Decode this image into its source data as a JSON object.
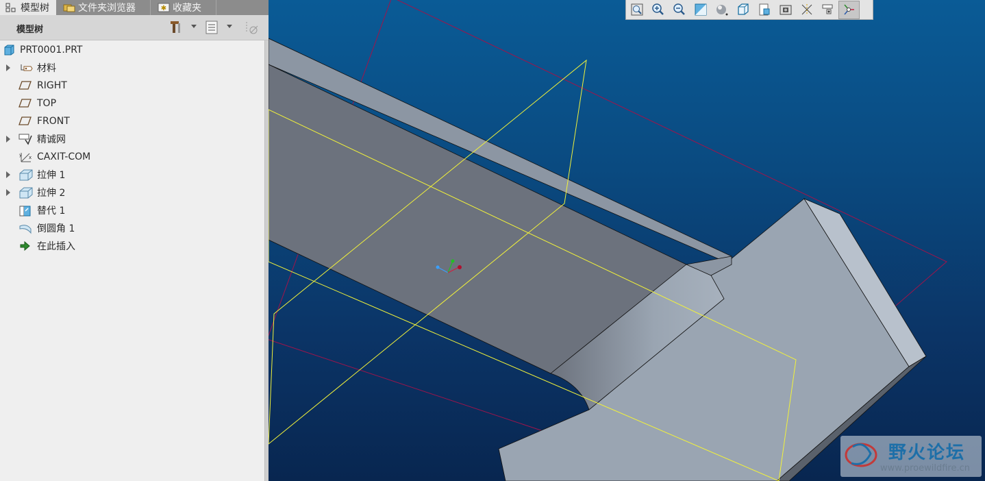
{
  "tabs": [
    {
      "label": "模型树",
      "icon": "model-tree-icon"
    },
    {
      "label": "文件夹浏览器",
      "icon": "folder-browser-icon"
    },
    {
      "label": "收藏夹",
      "icon": "favorites-icon"
    }
  ],
  "tree_header": {
    "title": "模型树",
    "buttons": [
      "tools-icon",
      "settings-list-icon",
      "show-hide-icon"
    ]
  },
  "tree": {
    "root": {
      "label": "PRT0001.PRT",
      "icon": "part-icon"
    },
    "items": [
      {
        "label": "材料",
        "icon": "material-icon",
        "expandable": true
      },
      {
        "label": "RIGHT",
        "icon": "datum-plane-icon",
        "expandable": false
      },
      {
        "label": "TOP",
        "icon": "datum-plane-icon",
        "expandable": false
      },
      {
        "label": "FRONT",
        "icon": "datum-plane-icon",
        "expandable": false
      },
      {
        "label": "精诚网",
        "icon": "feature-icon",
        "expandable": true
      },
      {
        "label": "CAXIT-COM",
        "icon": "coordinate-system-icon",
        "expandable": false
      },
      {
        "label": "拉伸 1",
        "icon": "extrude-icon",
        "expandable": true
      },
      {
        "label": "拉伸 2",
        "icon": "extrude-icon",
        "expandable": true
      },
      {
        "label": "替代 1",
        "icon": "substitute-icon",
        "expandable": false
      },
      {
        "label": "倒圆角 1",
        "icon": "round-icon",
        "expandable": false
      },
      {
        "label": "在此插入",
        "icon": "insert-here-icon",
        "expandable": false
      }
    ]
  },
  "view_toolbar": [
    "refit-icon",
    "zoom-in-icon",
    "zoom-out-icon",
    "repaint-icon",
    "display-style-icon",
    "saved-orientations-icon",
    "view-manager-icon",
    "perspective-icon",
    "datum-display-icon",
    "annotation-display-icon",
    "spin-center-icon"
  ],
  "watermark": {
    "title": "野火论坛",
    "url": "www.proewildfire.cn"
  },
  "colors": {
    "viewport_top": "#0a5b96",
    "viewport_bottom": "#082650",
    "datum_plane_yellow": "#f2f23a",
    "datum_plane_red": "#a0144a",
    "part_face_light": "#9aa5b2",
    "part_face_dark": "#6c727d"
  }
}
